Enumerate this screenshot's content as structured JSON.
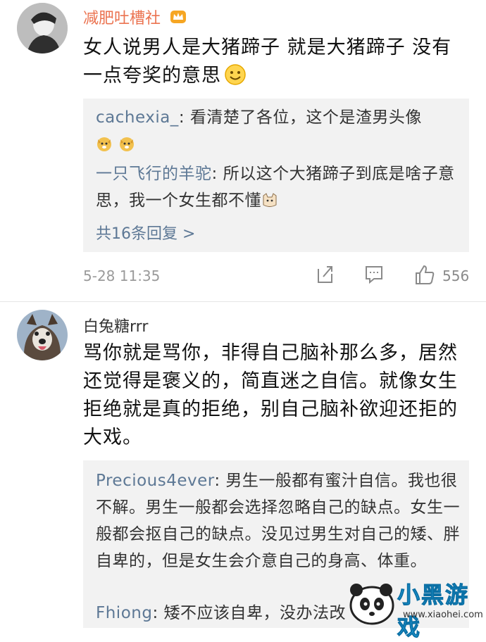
{
  "comments": [
    {
      "username": "减肥吐槽社",
      "text": "女人说男人是大猪蹄子 就是大猪蹄子 没有一点夸奖的意思",
      "replies": [
        {
          "name": "cachexia_",
          "text": "看清楚了各位，这个是渣男头像"
        },
        {
          "name": "一只飞行的羊驼",
          "text": "所以这个大猪蹄子到底是啥子意思，我一个女生都不懂"
        }
      ],
      "more_replies": "共16条回复 >",
      "timestamp": "5-28 11:35",
      "likes": "556"
    },
    {
      "username": "白兔糖rrr",
      "text": "骂你就是骂你，非得自己脑补那么多，居然还觉得是褒义的，简直迷之自信。就像女生拒绝就是真的拒绝，别自己脑补欲迎还拒的大戏。",
      "replies": [
        {
          "name": "Precious4ever",
          "text": "男生一般都有蜜汁自信。我也很不解。男生一般都会选择忽略自己的缺点。女生一般都会抠自己的缺点。没见过男生对自己的矮、胖自卑的，但是女生会介意自己的身高、体重。"
        },
        {
          "name": "Fhiong",
          "text": "矮不应该自卑，没办法改"
        }
      ]
    }
  ],
  "watermark": {
    "brand": "小黑游戏",
    "url": "www.xiaohei.com"
  },
  "colors": {
    "accent_name": "#eb7350",
    "reply_name": "#5d7895",
    "meta": "#9a9a9a"
  }
}
